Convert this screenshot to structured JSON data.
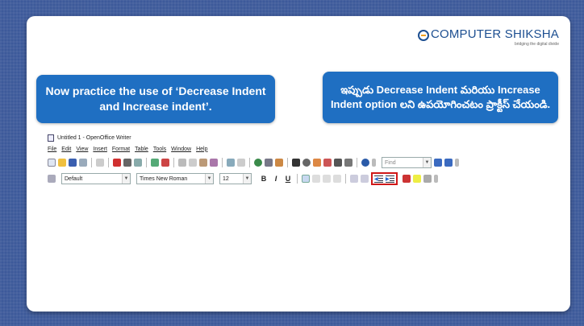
{
  "logo": {
    "text": "COMPUTER SHIKSHA",
    "tagline": "bridging the digital divide"
  },
  "callouts": {
    "english": "Now practice the use of ‘Decrease Indent and Increase indent’.",
    "telugu": "ఇప్పుడు Decrease Indent మరియు Increase Indent option లని ఉపయోగించటం ప్రాక్టీస్ చేయండి."
  },
  "writer": {
    "title": "Untitled 1 - OpenOffice Writer",
    "menu": [
      "File",
      "Edit",
      "View",
      "Insert",
      "Format",
      "Table",
      "Tools",
      "Window",
      "Help"
    ],
    "find_placeholder": "Find",
    "style_value": "Default",
    "font_value": "Times New Roman",
    "size_value": "12",
    "bold": "B",
    "italic": "I",
    "underline": "U",
    "highlighted_buttons": [
      "Decrease Indent",
      "Increase Indent"
    ]
  }
}
